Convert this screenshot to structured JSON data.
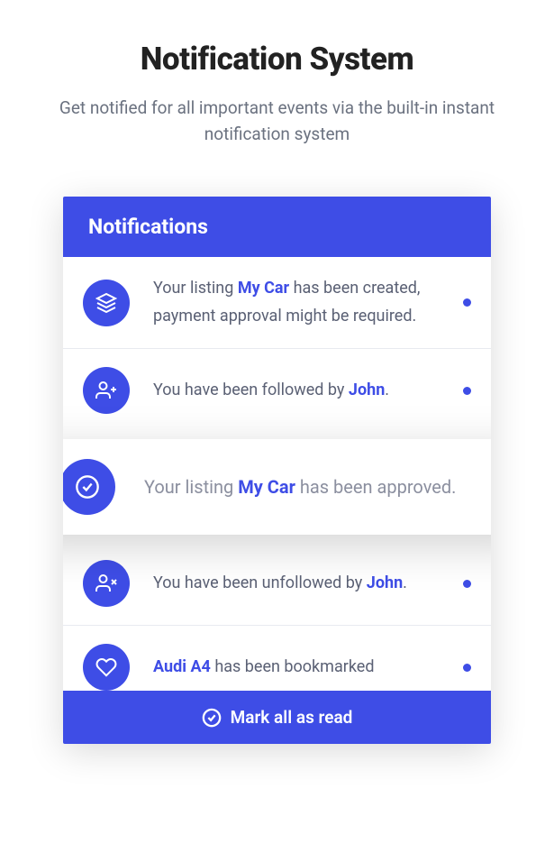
{
  "header": {
    "title": "Notification System",
    "subtitle": "Get notified for all important events via the built-in instant notification system"
  },
  "panel": {
    "title": "Notifications"
  },
  "notifications": [
    {
      "icon": "layers",
      "text_parts": [
        "Your listing ",
        "My Car",
        " has been created, payment approval might be required."
      ],
      "unread": true
    },
    {
      "icon": "user-plus",
      "text_parts": [
        "You have been followed by ",
        "John",
        "."
      ],
      "unread": true
    },
    {
      "icon": "check-circle",
      "text_parts": [
        "Your listing ",
        "My Car",
        " has been approved."
      ],
      "unread": true,
      "highlighted": true
    },
    {
      "icon": "user-x",
      "text_parts": [
        "You have been unfollowed by ",
        "John",
        "."
      ],
      "unread": true
    },
    {
      "icon": "heart",
      "text_parts": [
        "",
        "Audi A4",
        " has been bookmarked"
      ],
      "unread": true
    }
  ],
  "footer": {
    "button_label": "Mark all as read"
  }
}
